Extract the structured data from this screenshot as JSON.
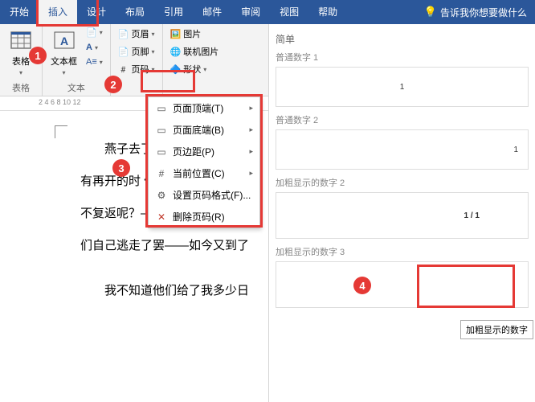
{
  "menubar": {
    "tabs": [
      "开始",
      "插入",
      "设计",
      "布局",
      "引用",
      "邮件",
      "审阅",
      "视图",
      "帮助"
    ],
    "active_index": 1,
    "tell_me": "告诉我你想要做什么"
  },
  "ribbon": {
    "group_table": "表格",
    "table_btn": "表格",
    "group_text": "文本",
    "textbox_btn": "文本框",
    "header_btn": "页眉",
    "footer_btn": "页脚",
    "pagenum_btn": "页码",
    "picture_btn": "图片",
    "online_pic_btn": "联机图片",
    "shapes_btn": "形状"
  },
  "dropdown": {
    "items": [
      {
        "label": "页面顶端(T)",
        "arrow": true
      },
      {
        "label": "页面底端(B)",
        "arrow": true
      },
      {
        "label": "页边距(P)",
        "arrow": true
      },
      {
        "label": "当前位置(C)",
        "arrow": true
      },
      {
        "label": "设置页码格式(F)...",
        "arrow": false
      },
      {
        "label": "删除页码(R)",
        "arrow": false
      }
    ]
  },
  "gallery": {
    "simple_header": "简单",
    "item1": "普通数字 1",
    "item2": "普通数字 2",
    "bold2": "加粗显示的数字 2",
    "bold3": "加粗显示的数字 3",
    "preview_num": "1",
    "preview_bold": "1 / 1",
    "tooltip": "加粗显示的数字"
  },
  "document": {
    "p1": "　　燕子去了",
    "p2": "有再开的时 候。但是，聪明的",
    "p3": "不复返呢？——是有人偷了他",
    "p4": "们自己逃走了罢——如今又到了",
    "p5": "　　我不知道他们给了我多少日"
  },
  "ruler": {
    "marks": "2        4        6        8       10       12"
  }
}
